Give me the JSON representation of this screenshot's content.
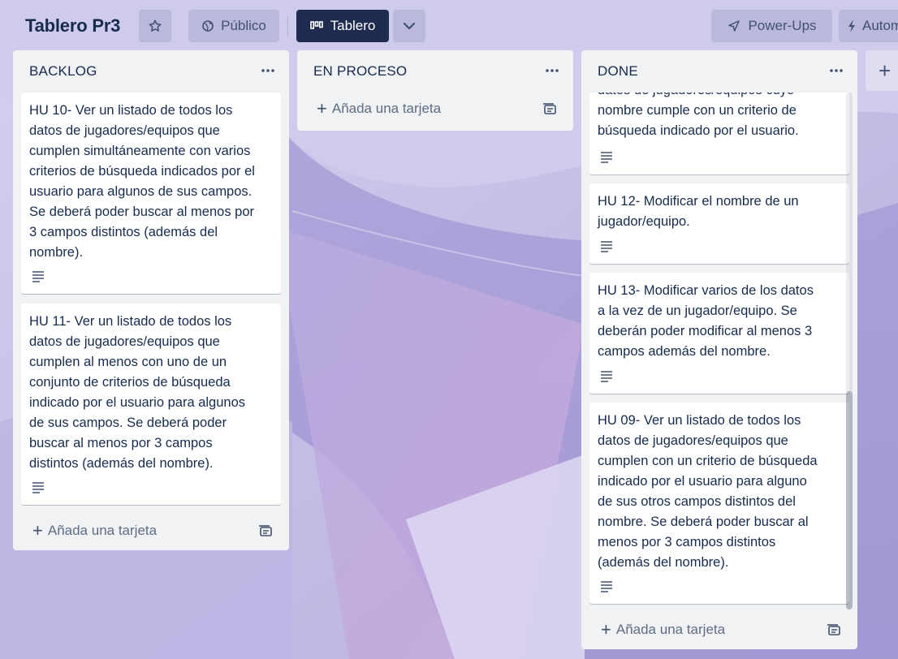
{
  "header": {
    "board_title": "Tablero Pr3",
    "visibility_label": "Público",
    "view_label": "Tablero",
    "powerups_label": "Power-Ups",
    "automation_label": "Autom"
  },
  "lists": [
    {
      "title": "BACKLOG",
      "cards": [
        "HU 10- Ver un listado de todos los\ndatos de jugadores/equipos que\ncumplen simultáneamente con varios\ncriterios de búsqueda indicados por el\nusuario para algunos de sus campos.\nSe deberá poder buscar al menos por\n3 campos distintos (además del\nnombre).",
        "HU 11- Ver un listado de todos los\ndatos de jugadores/equipos que\ncumplen al menos con uno de un\nconjunto de criterios de búsqueda\nindicado por el usuario para algunos\nde sus campos. Se deberá poder\nbuscar al menos por 3 campos\ndistintos (además del nombre)."
      ],
      "add_card_label": "Añada una tarjeta"
    },
    {
      "title": "EN PROCESO",
      "cards": [],
      "add_card_label": "Añada una tarjeta"
    },
    {
      "title": "DONE",
      "cards": [
        "datos de jugadores/equipos cuyo\nnombre cumple con un criterio de\nbúsqueda indicado por el usuario.",
        "HU 12- Modificar el nombre de un\njugador/equipo.",
        "HU 13- Modificar varios de los datos\na la vez de un jugador/equipo. Se\ndeberán poder modificar al menos 3\ncampos además del nombre.",
        "HU 09- Ver un listado de todos los\ndatos de jugadores/equipos que\ncumplen con un criterio de búsqueda\nindicado por el usuario para alguno\nde sus otros campos distintos del\nnombre. Se deberá poder buscar al\nmenos por 3 campos distintos\n(además del nombre)."
      ],
      "add_card_label": "Añada una tarjeta"
    }
  ],
  "add_list_label": "+",
  "colors": {
    "board_button_bg": "#1f2c4f",
    "list_bg": "#f1f2f4",
    "text_primary": "#172b4d",
    "text_secondary": "#5e6c84"
  }
}
